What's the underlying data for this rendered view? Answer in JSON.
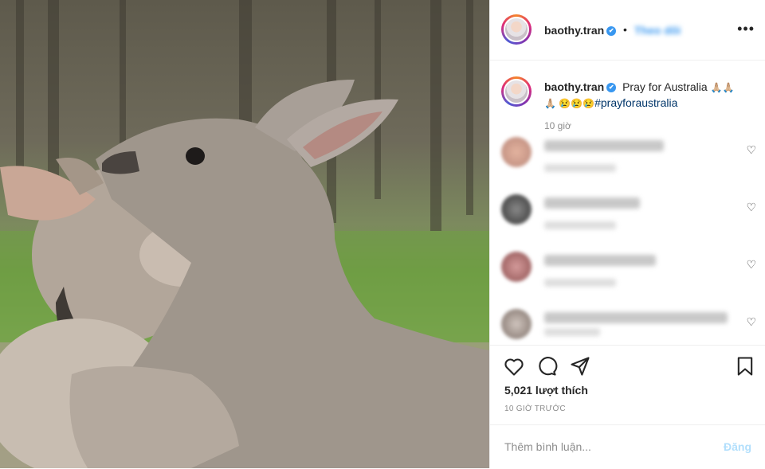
{
  "header": {
    "username": "baothy.tran",
    "verified_mark": "✔",
    "separator": "•",
    "follow_label": "Theo dõi",
    "more_icon": "more-horizontal-icon",
    "more_label": "•••"
  },
  "caption": {
    "username": "baothy.tran",
    "verified_mark": "✔",
    "text": "Pray for Australia",
    "emoji_1": "🙏🏼🙏🏼",
    "emoji_2": "🙏🏼 😢😢😢",
    "hashtag": "#prayforaustralia",
    "time": "10 giờ"
  },
  "actions": {
    "like_icon": "heart-icon",
    "comment_icon": "comment-icon",
    "share_icon": "send-icon",
    "save_icon": "bookmark-icon"
  },
  "likes_text": "5,021 lượt thích",
  "time_ago": "10 GIỜ TRƯỚC",
  "comment_box": {
    "placeholder": "Thêm bình luận...",
    "post_label": "Đăng"
  },
  "comment_heart": "♡",
  "colors": {
    "accent": "#3897f0",
    "post_disabled": "#b2dffc",
    "border": "#efefef",
    "muted": "#8e8e8e"
  }
}
